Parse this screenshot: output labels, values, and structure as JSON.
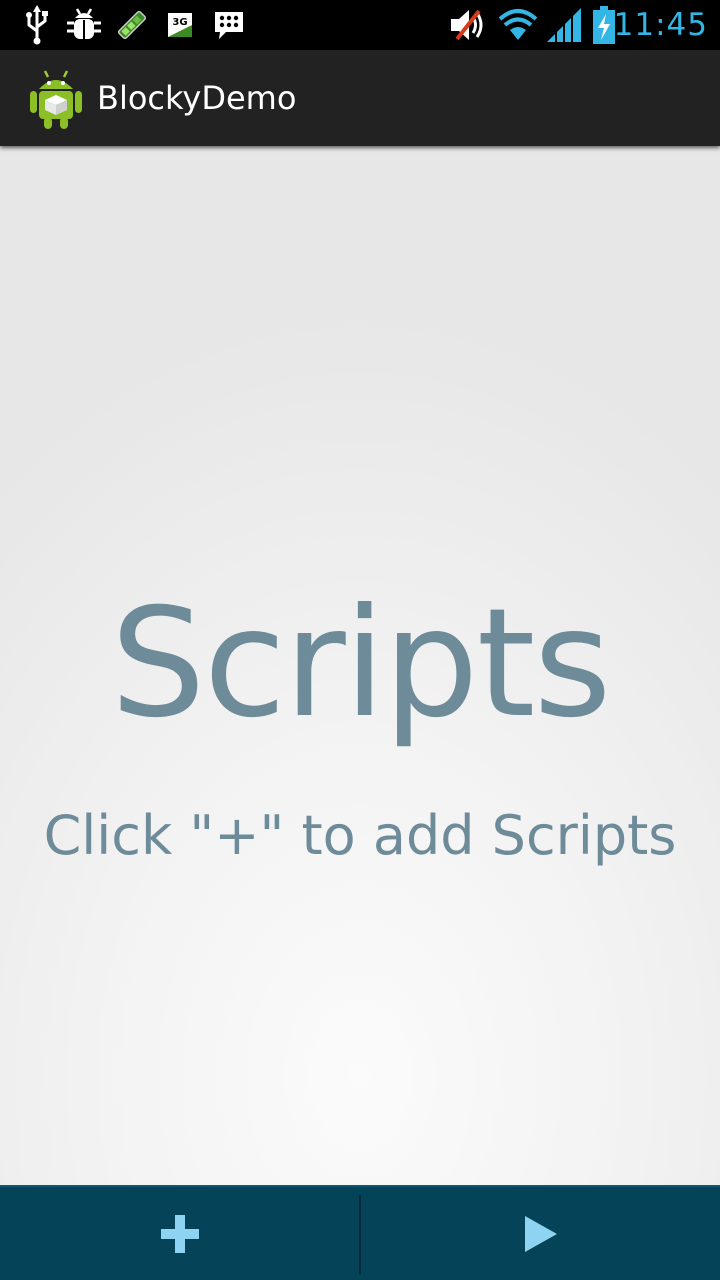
{
  "status_bar": {
    "time": "11:45",
    "left_icons": [
      "usb-icon",
      "debug-icon",
      "download-icon",
      "network-3g-icon",
      "bbm-icon"
    ],
    "right_icons": [
      "mute-icon",
      "wifi-icon",
      "signal-icon",
      "battery-charging-icon"
    ],
    "network_label": "3G",
    "accent_color": "#33b5e5"
  },
  "action_bar": {
    "title": "BlockyDemo",
    "icon": "android-cube-icon",
    "background": "#222222"
  },
  "content": {
    "empty_title": "Scripts",
    "empty_hint": "Click \"+\" to add Scripts",
    "text_color": "#6e8b99"
  },
  "bottom_bar": {
    "background": "#054458",
    "icon_color": "#8fd3f2",
    "add_icon": "plus-icon",
    "run_icon": "play-icon"
  }
}
